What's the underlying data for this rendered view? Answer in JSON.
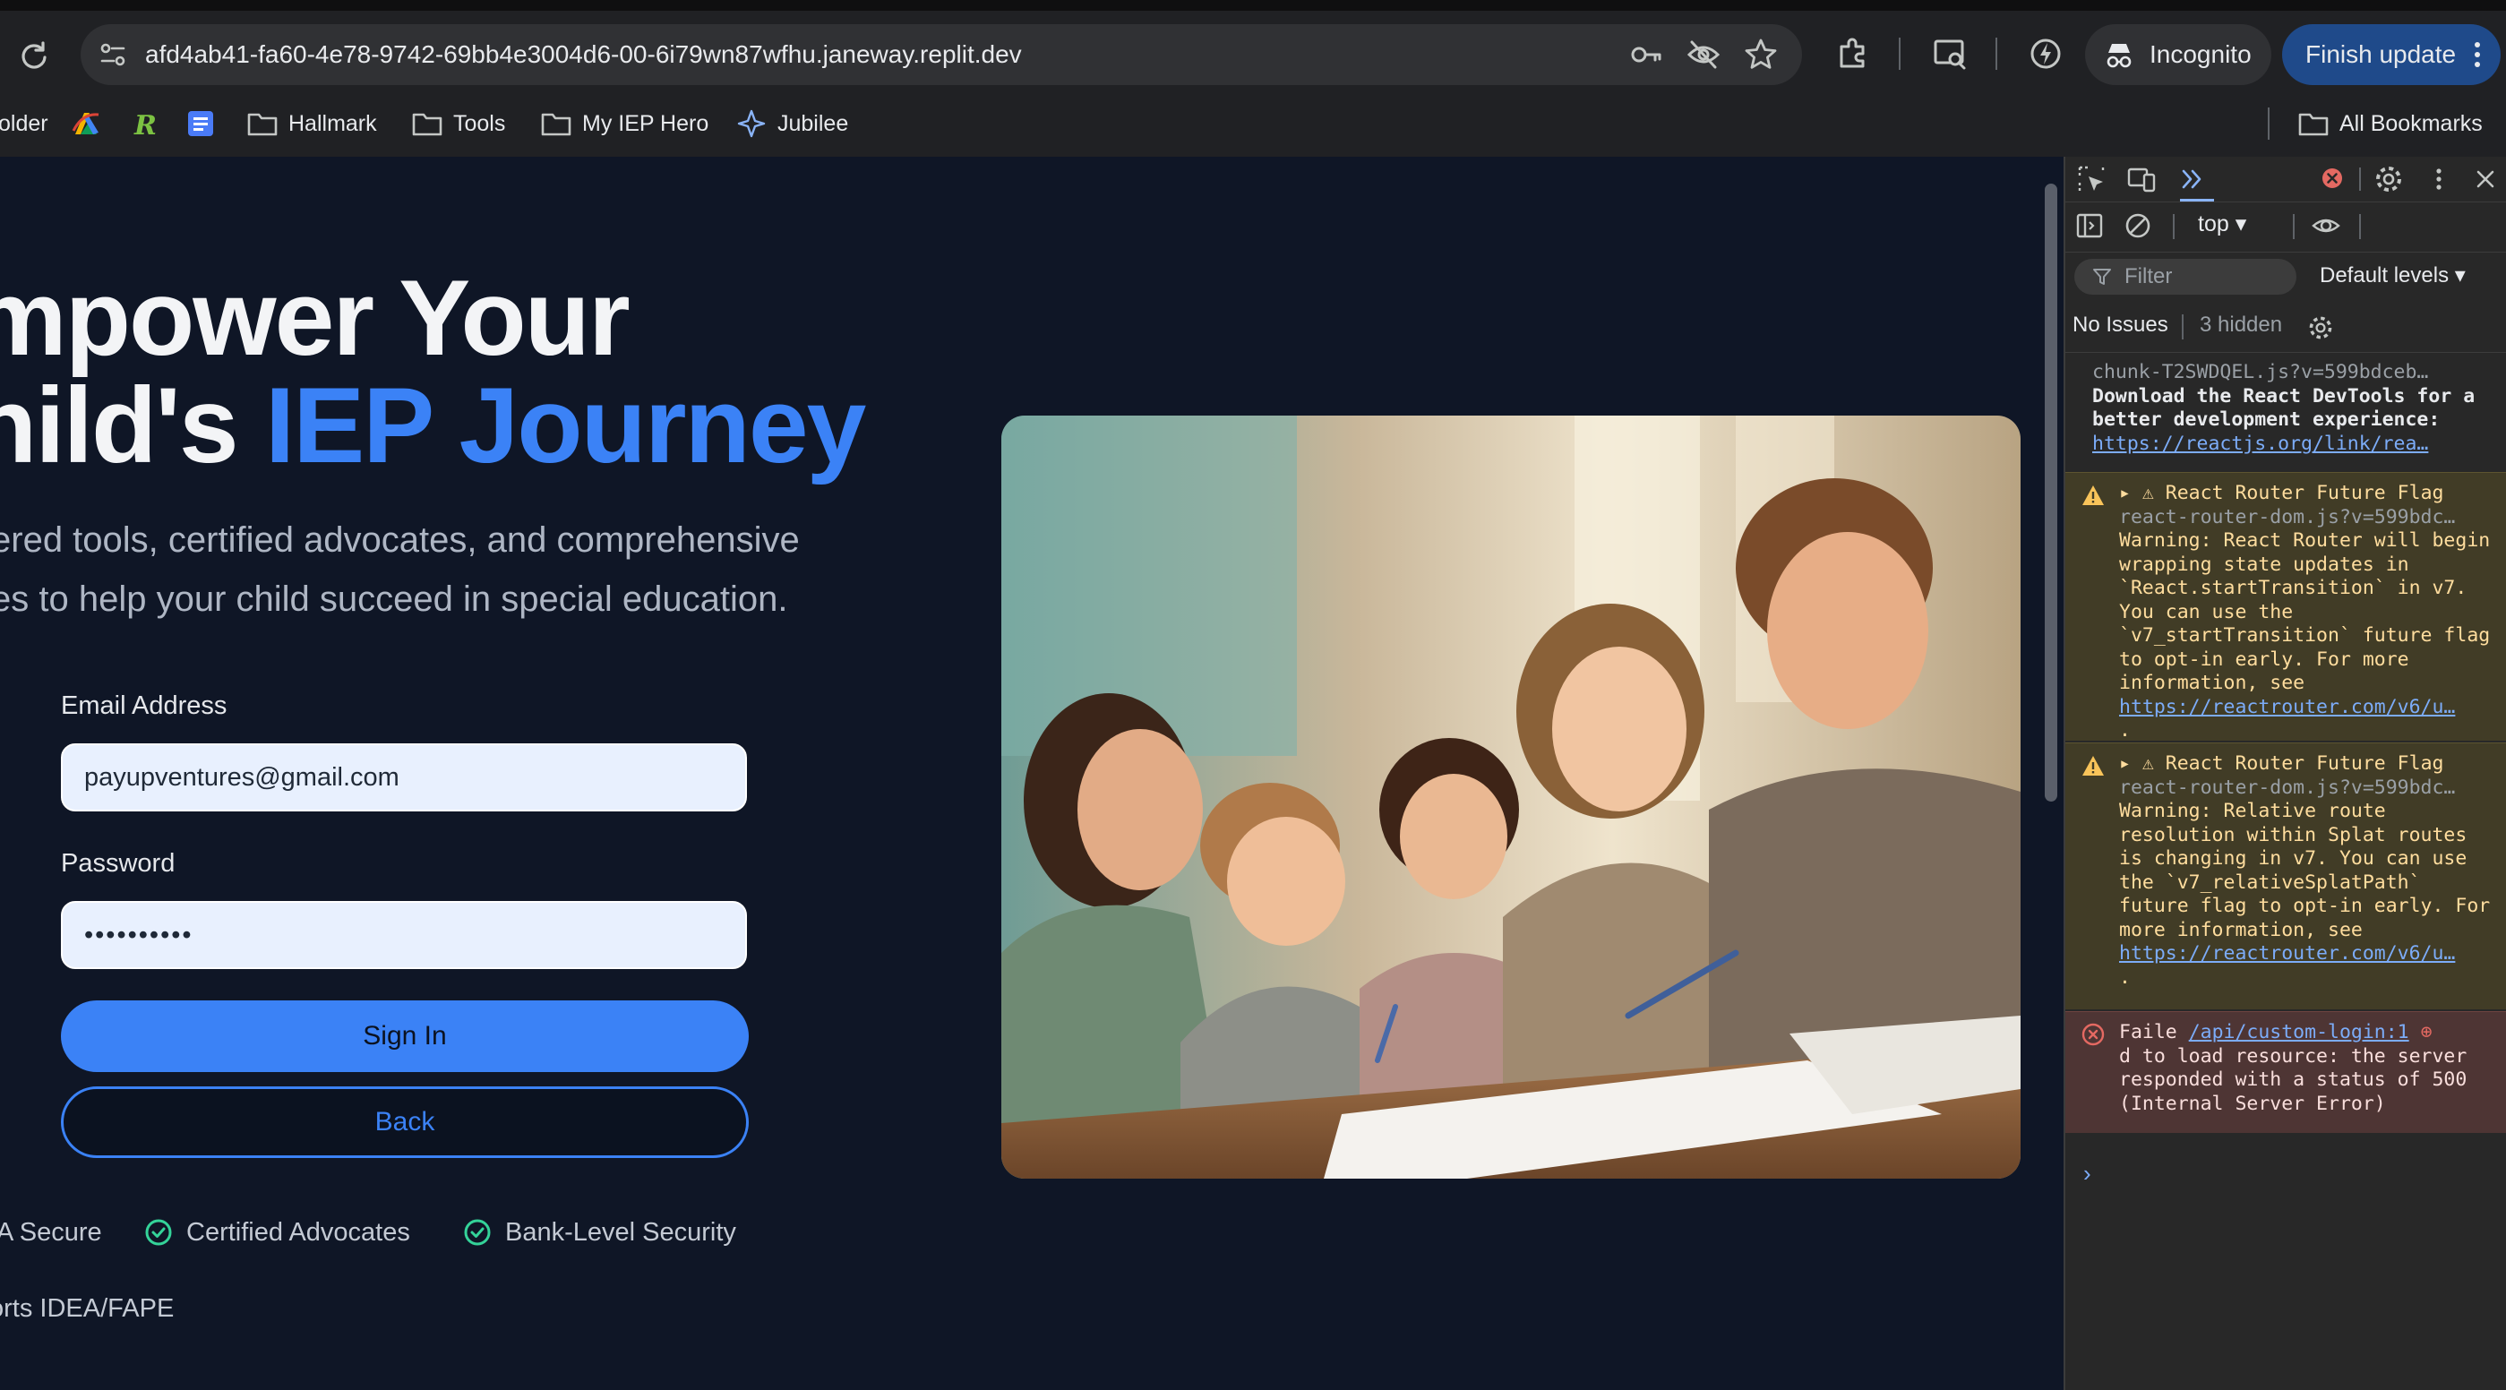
{
  "browser": {
    "url": "afd4ab41-fa60-4e78-9742-69bb4e3004d6-00-6i79wn87wfhu.janeway.replit.dev",
    "incognito_label": "Incognito",
    "finish_update_label": "Finish update",
    "bookmarks": [
      {
        "label": "older",
        "icon": "folder-icon"
      },
      {
        "label": "",
        "icon": "drive-colorful-icon"
      },
      {
        "label": "",
        "icon": "r-green-icon"
      },
      {
        "label": "",
        "icon": "docs-icon"
      },
      {
        "label": "Hallmark",
        "icon": "folder-icon"
      },
      {
        "label": "Tools",
        "icon": "folder-icon"
      },
      {
        "label": "My IEP Hero",
        "icon": "folder-icon"
      },
      {
        "label": "Jubilee",
        "icon": "jubilee-icon"
      }
    ],
    "all_bookmarks_label": "All Bookmarks"
  },
  "page": {
    "heading_line1": "mpower Your",
    "heading_line2_a": "hild's ",
    "heading_line2_b": "IEP Journey",
    "subtitle_line1": "vered tools, certified advocates, and comprehensive",
    "subtitle_line2": "ces to help your child succeed in special education.",
    "email_label": "Email Address",
    "email_value": "payupventures@gmail.com",
    "password_label": "Password",
    "password_value": "••••••••••",
    "signin_label": "Sign In",
    "back_label": "Back",
    "badges": [
      "A Secure",
      "Certified Advocates",
      "Bank-Level Security"
    ],
    "footnote": "orts IDEA/FAPE",
    "accent_color": "#3b82f6"
  },
  "devtools": {
    "context": "top",
    "filter_placeholder": "Filter",
    "levels": "Default levels",
    "no_issues": "No Issues",
    "hidden": "3 hidden",
    "messages": [
      {
        "type": "info",
        "source": "chunk-T2SWDQEL.js?v=599bdceb…",
        "text": "Download the React DevTools for a better development experience:",
        "link": "https://reactjs.org/link/rea…"
      },
      {
        "type": "warning",
        "title": "React Router Future Flag",
        "source": "react-router-dom.js?v=599bdc…",
        "text": "Warning: React Router will begin wrapping state updates in `React.startTransition` in v7. You can use the `v7_startTransition` future flag to opt-in early. For more information, see",
        "link": "https://reactrouter.com/v6/u…",
        "tail": "."
      },
      {
        "type": "warning",
        "title": "React Router Future Flag",
        "source": "react-router-dom.js?v=599bdc…",
        "text": "Warning: Relative route resolution within Splat routes is changing in v7. You can use the `v7_relativeSplatPath` future flag to opt-in early. For more information, see",
        "link": "https://reactrouter.com/v6/u…",
        "tail": "."
      },
      {
        "type": "error",
        "prefix": "Faile",
        "link": "/api/custom-login:1",
        "text": "d to load resource: the server responded with a status of 500 (Internal Server Error)"
      }
    ],
    "prompt": "›"
  }
}
